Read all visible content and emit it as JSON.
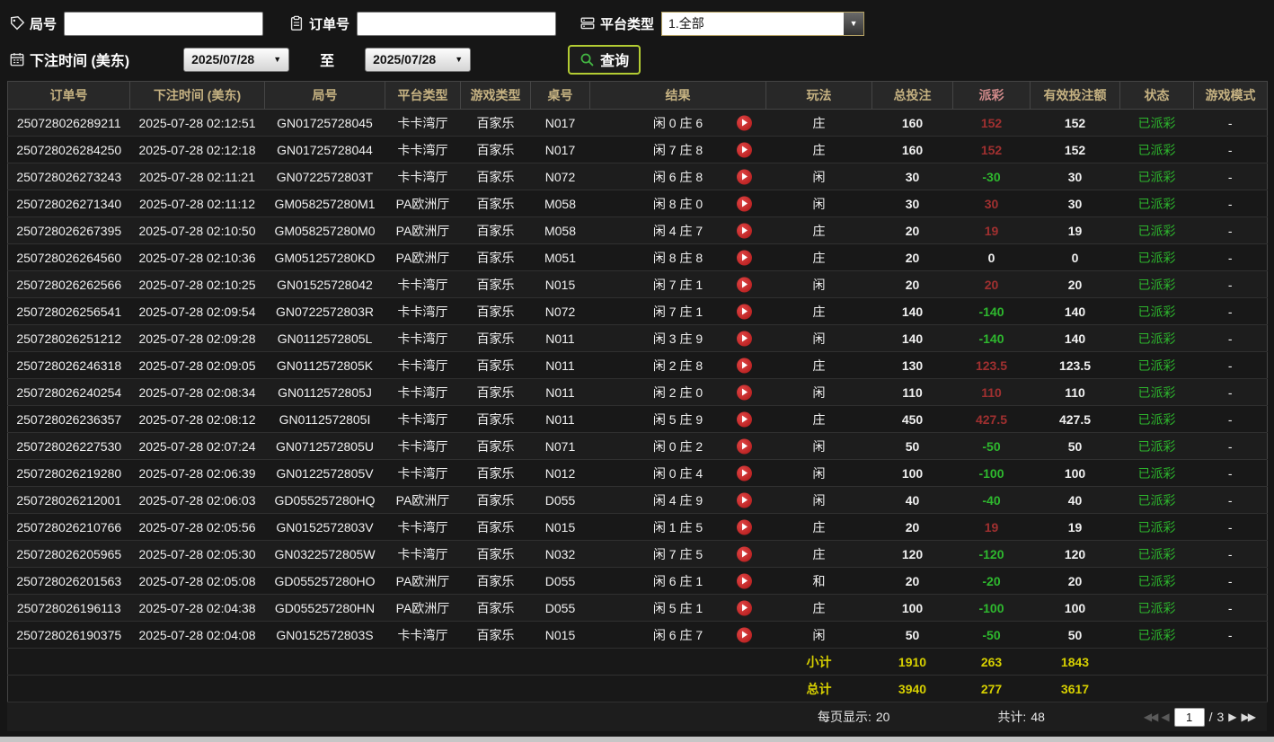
{
  "filters": {
    "round": {
      "label": "局号",
      "value": ""
    },
    "order": {
      "label": "订单号",
      "value": ""
    },
    "platform": {
      "label": "平台类型",
      "value": "1.全部"
    },
    "bet_time": {
      "label": "下注时间 (美东)",
      "from": "2025/07/28",
      "to_label": "至",
      "to": "2025/07/28"
    },
    "query_button": "查询"
  },
  "table": {
    "headers": [
      "订单号",
      "下注时间 (美东)",
      "局号",
      "平台类型",
      "游戏类型",
      "桌号",
      "结果",
      "玩法",
      "总投注",
      "派彩",
      "有效投注额",
      "状态",
      "游戏模式"
    ],
    "highlight_header_index": 9,
    "rows": [
      {
        "order_no": "250728026289211",
        "bet_time": "2025-07-28 02:12:51",
        "round_no": "GN01725728045",
        "platform": "卡卡湾厅",
        "game_type": "百家乐",
        "table_no": "N017",
        "result": "闲 0 庄 6",
        "play": "庄",
        "total_bet": "160",
        "payout": "152",
        "payout_type": "win",
        "valid_bet": "152",
        "status": "已派彩",
        "mode": "-"
      },
      {
        "order_no": "250728026284250",
        "bet_time": "2025-07-28 02:12:18",
        "round_no": "GN01725728044",
        "platform": "卡卡湾厅",
        "game_type": "百家乐",
        "table_no": "N017",
        "result": "闲 7 庄 8",
        "play": "庄",
        "total_bet": "160",
        "payout": "152",
        "payout_type": "win",
        "valid_bet": "152",
        "status": "已派彩",
        "mode": "-"
      },
      {
        "order_no": "250728026273243",
        "bet_time": "2025-07-28 02:11:21",
        "round_no": "GN0722572803T",
        "platform": "卡卡湾厅",
        "game_type": "百家乐",
        "table_no": "N072",
        "result": "闲 6 庄 8",
        "play": "闲",
        "total_bet": "30",
        "payout": "-30",
        "payout_type": "loss",
        "valid_bet": "30",
        "status": "已派彩",
        "mode": "-"
      },
      {
        "order_no": "250728026271340",
        "bet_time": "2025-07-28 02:11:12",
        "round_no": "GM058257280M1",
        "platform": "PA欧洲厅",
        "game_type": "百家乐",
        "table_no": "M058",
        "result": "闲 8 庄 0",
        "play": "闲",
        "total_bet": "30",
        "payout": "30",
        "payout_type": "win",
        "valid_bet": "30",
        "status": "已派彩",
        "mode": "-"
      },
      {
        "order_no": "250728026267395",
        "bet_time": "2025-07-28 02:10:50",
        "round_no": "GM058257280M0",
        "platform": "PA欧洲厅",
        "game_type": "百家乐",
        "table_no": "M058",
        "result": "闲 4 庄 7",
        "play": "庄",
        "total_bet": "20",
        "payout": "19",
        "payout_type": "win",
        "valid_bet": "19",
        "status": "已派彩",
        "mode": "-"
      },
      {
        "order_no": "250728026264560",
        "bet_time": "2025-07-28 02:10:36",
        "round_no": "GM051257280KD",
        "platform": "PA欧洲厅",
        "game_type": "百家乐",
        "table_no": "M051",
        "result": "闲 8 庄 8",
        "play": "庄",
        "total_bet": "20",
        "payout": "0",
        "payout_type": "zero",
        "valid_bet": "0",
        "status": "已派彩",
        "mode": "-"
      },
      {
        "order_no": "250728026262566",
        "bet_time": "2025-07-28 02:10:25",
        "round_no": "GN01525728042",
        "platform": "卡卡湾厅",
        "game_type": "百家乐",
        "table_no": "N015",
        "result": "闲 7 庄 1",
        "play": "闲",
        "total_bet": "20",
        "payout": "20",
        "payout_type": "win",
        "valid_bet": "20",
        "status": "已派彩",
        "mode": "-"
      },
      {
        "order_no": "250728026256541",
        "bet_time": "2025-07-28 02:09:54",
        "round_no": "GN0722572803R",
        "platform": "卡卡湾厅",
        "game_type": "百家乐",
        "table_no": "N072",
        "result": "闲 7 庄 1",
        "play": "庄",
        "total_bet": "140",
        "payout": "-140",
        "payout_type": "loss",
        "valid_bet": "140",
        "status": "已派彩",
        "mode": "-"
      },
      {
        "order_no": "250728026251212",
        "bet_time": "2025-07-28 02:09:28",
        "round_no": "GN0112572805L",
        "platform": "卡卡湾厅",
        "game_type": "百家乐",
        "table_no": "N011",
        "result": "闲 3 庄 9",
        "play": "闲",
        "total_bet": "140",
        "payout": "-140",
        "payout_type": "loss",
        "valid_bet": "140",
        "status": "已派彩",
        "mode": "-"
      },
      {
        "order_no": "250728026246318",
        "bet_time": "2025-07-28 02:09:05",
        "round_no": "GN0112572805K",
        "platform": "卡卡湾厅",
        "game_type": "百家乐",
        "table_no": "N011",
        "result": "闲 2 庄 8",
        "play": "庄",
        "total_bet": "130",
        "payout": "123.5",
        "payout_type": "win",
        "valid_bet": "123.5",
        "status": "已派彩",
        "mode": "-"
      },
      {
        "order_no": "250728026240254",
        "bet_time": "2025-07-28 02:08:34",
        "round_no": "GN0112572805J",
        "platform": "卡卡湾厅",
        "game_type": "百家乐",
        "table_no": "N011",
        "result": "闲 2 庄 0",
        "play": "闲",
        "total_bet": "110",
        "payout": "110",
        "payout_type": "win",
        "valid_bet": "110",
        "status": "已派彩",
        "mode": "-"
      },
      {
        "order_no": "250728026236357",
        "bet_time": "2025-07-28 02:08:12",
        "round_no": "GN0112572805I",
        "platform": "卡卡湾厅",
        "game_type": "百家乐",
        "table_no": "N011",
        "result": "闲 5 庄 9",
        "play": "庄",
        "total_bet": "450",
        "payout": "427.5",
        "payout_type": "win",
        "valid_bet": "427.5",
        "status": "已派彩",
        "mode": "-"
      },
      {
        "order_no": "250728026227530",
        "bet_time": "2025-07-28 02:07:24",
        "round_no": "GN0712572805U",
        "platform": "卡卡湾厅",
        "game_type": "百家乐",
        "table_no": "N071",
        "result": "闲 0 庄 2",
        "play": "闲",
        "total_bet": "50",
        "payout": "-50",
        "payout_type": "loss",
        "valid_bet": "50",
        "status": "已派彩",
        "mode": "-"
      },
      {
        "order_no": "250728026219280",
        "bet_time": "2025-07-28 02:06:39",
        "round_no": "GN0122572805V",
        "platform": "卡卡湾厅",
        "game_type": "百家乐",
        "table_no": "N012",
        "result": "闲 0 庄 4",
        "play": "闲",
        "total_bet": "100",
        "payout": "-100",
        "payout_type": "loss",
        "valid_bet": "100",
        "status": "已派彩",
        "mode": "-"
      },
      {
        "order_no": "250728026212001",
        "bet_time": "2025-07-28 02:06:03",
        "round_no": "GD055257280HQ",
        "platform": "PA欧洲厅",
        "game_type": "百家乐",
        "table_no": "D055",
        "result": "闲 4 庄 9",
        "play": "闲",
        "total_bet": "40",
        "payout": "-40",
        "payout_type": "loss",
        "valid_bet": "40",
        "status": "已派彩",
        "mode": "-"
      },
      {
        "order_no": "250728026210766",
        "bet_time": "2025-07-28 02:05:56",
        "round_no": "GN0152572803V",
        "platform": "卡卡湾厅",
        "game_type": "百家乐",
        "table_no": "N015",
        "result": "闲 1 庄 5",
        "play": "庄",
        "total_bet": "20",
        "payout": "19",
        "payout_type": "win",
        "valid_bet": "19",
        "status": "已派彩",
        "mode": "-"
      },
      {
        "order_no": "250728026205965",
        "bet_time": "2025-07-28 02:05:30",
        "round_no": "GN0322572805W",
        "platform": "卡卡湾厅",
        "game_type": "百家乐",
        "table_no": "N032",
        "result": "闲 7 庄 5",
        "play": "庄",
        "total_bet": "120",
        "payout": "-120",
        "payout_type": "loss",
        "valid_bet": "120",
        "status": "已派彩",
        "mode": "-"
      },
      {
        "order_no": "250728026201563",
        "bet_time": "2025-07-28 02:05:08",
        "round_no": "GD055257280HO",
        "platform": "PA欧洲厅",
        "game_type": "百家乐",
        "table_no": "D055",
        "result": "闲 6 庄 1",
        "play": "和",
        "total_bet": "20",
        "payout": "-20",
        "payout_type": "loss",
        "valid_bet": "20",
        "status": "已派彩",
        "mode": "-"
      },
      {
        "order_no": "250728026196113",
        "bet_time": "2025-07-28 02:04:38",
        "round_no": "GD055257280HN",
        "platform": "PA欧洲厅",
        "game_type": "百家乐",
        "table_no": "D055",
        "result": "闲 5 庄 1",
        "play": "庄",
        "total_bet": "100",
        "payout": "-100",
        "payout_type": "loss",
        "valid_bet": "100",
        "status": "已派彩",
        "mode": "-"
      },
      {
        "order_no": "250728026190375",
        "bet_time": "2025-07-28 02:04:08",
        "round_no": "GN0152572803S",
        "platform": "卡卡湾厅",
        "game_type": "百家乐",
        "table_no": "N015",
        "result": "闲 6 庄 7",
        "play": "闲",
        "total_bet": "50",
        "payout": "-50",
        "payout_type": "loss",
        "valid_bet": "50",
        "status": "已派彩",
        "mode": "-"
      }
    ]
  },
  "summary": {
    "subtotal": {
      "label": "小计",
      "total_bet": "1910",
      "payout": "263",
      "valid_bet": "1843"
    },
    "total": {
      "label": "总计",
      "total_bet": "3940",
      "payout": "277",
      "valid_bet": "3617"
    }
  },
  "pagination": {
    "per_page_label": "每页显示:",
    "per_page_value": "20",
    "total_label": "共计:",
    "total_value": "48",
    "page": "1",
    "page_separator": "/",
    "total_pages": "3"
  },
  "colors": {
    "win": "#a03030",
    "loss": "#2eb82e",
    "status_paid": "#2db52d",
    "summary_yellow": "#d6cf00",
    "header_text": "#c6b282",
    "query_border": "#b3cc33"
  }
}
